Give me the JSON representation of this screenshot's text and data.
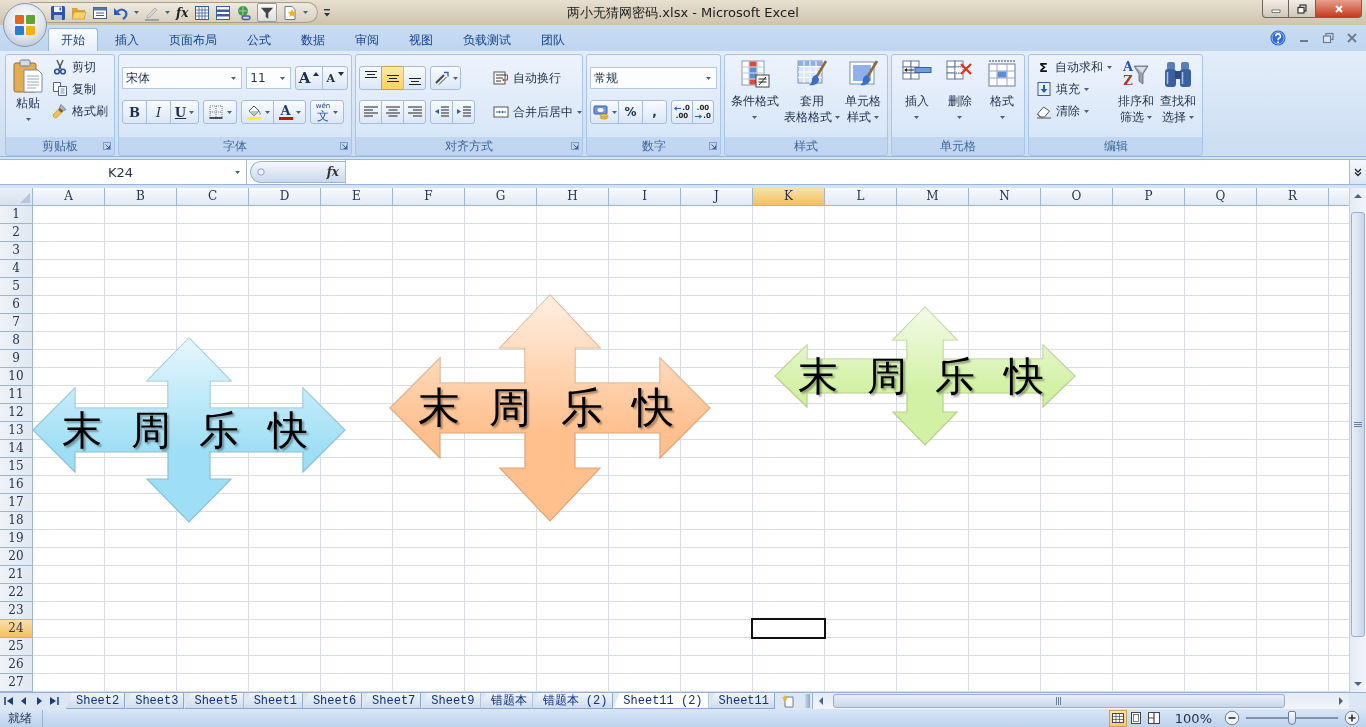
{
  "window": {
    "title": "两小无猜网密码.xlsx - Microsoft Excel"
  },
  "quick_access": {
    "function_label": "fx",
    "filter_on": true
  },
  "ribbon_tabs": [
    {
      "label": "开始",
      "selected": true
    },
    {
      "label": "插入",
      "selected": false
    },
    {
      "label": "页面布局",
      "selected": false
    },
    {
      "label": "公式",
      "selected": false
    },
    {
      "label": "数据",
      "selected": false
    },
    {
      "label": "审阅",
      "selected": false
    },
    {
      "label": "视图",
      "selected": false
    },
    {
      "label": "负载测试",
      "selected": false
    },
    {
      "label": "团队",
      "selected": false
    }
  ],
  "ribbon": {
    "clipboard": {
      "label": "剪贴板",
      "paste": "粘贴",
      "commands": [
        "剪切",
        "复制",
        "格式刷"
      ]
    },
    "font": {
      "label": "字体",
      "font_name": "宋体",
      "font_size": "11",
      "grow_font": "A",
      "shrink_font": "A",
      "style_buttons": [
        "B",
        "I",
        "U"
      ],
      "font_color": "A",
      "phonetic_guide": {
        "ruby": "wén",
        "base": "文"
      }
    },
    "alignment": {
      "label": "对齐方式",
      "vertical_alignment": [
        {
          "selected": false
        },
        {
          "selected": true
        },
        {
          "selected": false
        }
      ],
      "wrap_text": "自动换行",
      "merge_and_center": "合并后居中"
    },
    "number": {
      "label": "数字",
      "format": "常规",
      "percent": "%",
      "comma": ",",
      "increase_decimal": [
        ".0",
        ".00"
      ],
      "decrease_decimal": [
        ".00",
        ".0"
      ]
    },
    "styles": {
      "label": "样式",
      "buttons": [
        {
          "lines": [
            "条件格式"
          ]
        },
        {
          "lines": [
            "套用",
            "表格格式"
          ]
        },
        {
          "lines": [
            "单元格",
            "样式"
          ]
        }
      ]
    },
    "cells": {
      "label": "单元格",
      "buttons": [
        {
          "lines": [
            "插入"
          ]
        },
        {
          "lines": [
            "删除"
          ]
        },
        {
          "lines": [
            "格式"
          ]
        }
      ]
    },
    "editing": {
      "label": "编辑",
      "autosum_symbol": "Σ",
      "commands": [
        "自动求和",
        "填充",
        "清除"
      ],
      "sort_letters": [
        "A",
        "Z"
      ],
      "buttons": [
        {
          "lines": [
            "排序和",
            "筛选"
          ]
        },
        {
          "lines": [
            "查找和",
            "选择"
          ]
        }
      ]
    }
  },
  "formula_bar": {
    "name_box": "K24",
    "insert_function": "fx"
  },
  "sheet": {
    "columns": [
      {
        "label": "A",
        "selected": false
      },
      {
        "label": "B",
        "selected": false
      },
      {
        "label": "C",
        "selected": false
      },
      {
        "label": "D",
        "selected": false
      },
      {
        "label": "E",
        "selected": false
      },
      {
        "label": "F",
        "selected": false
      },
      {
        "label": "G",
        "selected": false
      },
      {
        "label": "H",
        "selected": false
      },
      {
        "label": "I",
        "selected": false
      },
      {
        "label": "J",
        "selected": false
      },
      {
        "label": "K",
        "selected": true
      },
      {
        "label": "L",
        "selected": false
      },
      {
        "label": "M",
        "selected": false
      },
      {
        "label": "N",
        "selected": false
      },
      {
        "label": "O",
        "selected": false
      },
      {
        "label": "P",
        "selected": false
      },
      {
        "label": "Q",
        "selected": false
      },
      {
        "label": "R",
        "selected": false
      }
    ],
    "rows": [
      {
        "label": "1",
        "selected": false
      },
      {
        "label": "2",
        "selected": false
      },
      {
        "label": "3",
        "selected": false
      },
      {
        "label": "4",
        "selected": false
      },
      {
        "label": "5",
        "selected": false
      },
      {
        "label": "6",
        "selected": false
      },
      {
        "label": "7",
        "selected": false
      },
      {
        "label": "8",
        "selected": false
      },
      {
        "label": "9",
        "selected": false
      },
      {
        "label": "10",
        "selected": false
      },
      {
        "label": "11",
        "selected": false
      },
      {
        "label": "12",
        "selected": false
      },
      {
        "label": "13",
        "selected": false
      },
      {
        "label": "14",
        "selected": false
      },
      {
        "label": "15",
        "selected": false
      },
      {
        "label": "16",
        "selected": false
      },
      {
        "label": "17",
        "selected": false
      },
      {
        "label": "18",
        "selected": false
      },
      {
        "label": "19",
        "selected": false
      },
      {
        "label": "20",
        "selected": false
      },
      {
        "label": "21",
        "selected": false
      },
      {
        "label": "22",
        "selected": false
      },
      {
        "label": "23",
        "selected": false
      },
      {
        "label": "24",
        "selected": true
      },
      {
        "label": "25",
        "selected": false
      },
      {
        "label": "26",
        "selected": false
      },
      {
        "label": "27",
        "selected": false
      }
    ]
  },
  "shapes": [
    {
      "text": "末 周 乐 快",
      "color": "#9fdff5"
    },
    {
      "text": "末 周 乐 快",
      "color": "#ffc08e"
    },
    {
      "text": "末 周 乐 快",
      "color": "#d2f1a4"
    }
  ],
  "sheet_tabs": [
    {
      "label": "Sheet2",
      "selected": false
    },
    {
      "label": "Sheet3",
      "selected": false
    },
    {
      "label": "Sheet5",
      "selected": false
    },
    {
      "label": "Sheet1",
      "selected": false
    },
    {
      "label": "Sheet6",
      "selected": false
    },
    {
      "label": "Sheet7",
      "selected": false
    },
    {
      "label": "Sheet9",
      "selected": false
    },
    {
      "label": "错题本",
      "selected": false
    },
    {
      "label": "错题本 (2)",
      "selected": false
    },
    {
      "label": "Sheet11 (2)",
      "selected": true
    },
    {
      "label": "Sheet11",
      "selected": false
    }
  ],
  "status_bar": {
    "status": "就绪",
    "view_buttons": [
      {
        "selected": true
      },
      {
        "selected": false
      },
      {
        "selected": false
      }
    ],
    "zoom": {
      "label": "100%",
      "level": 0.5
    }
  }
}
